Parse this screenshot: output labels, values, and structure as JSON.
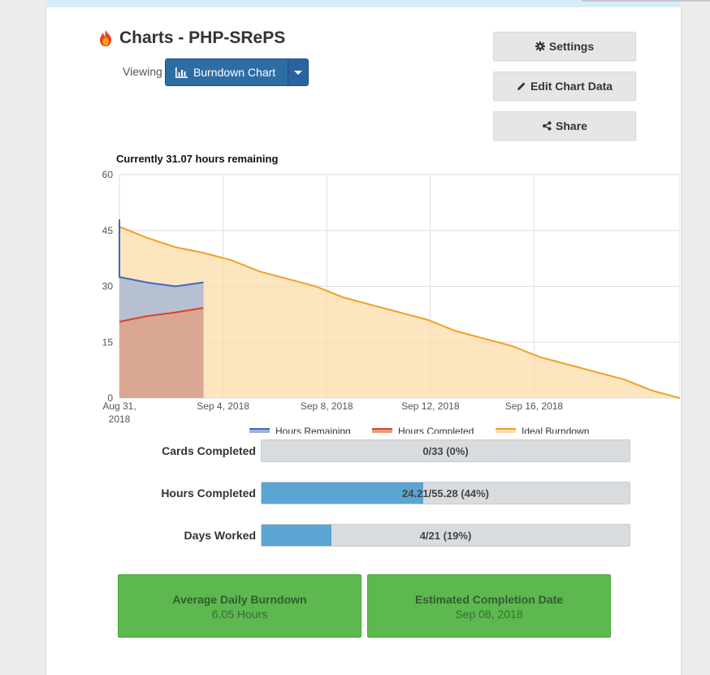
{
  "header": {
    "title": "Charts - PHP-SRePS",
    "viewing_label": "Viewing",
    "chart_selector": "Burndown Chart"
  },
  "actions": {
    "settings": "Settings",
    "edit_chart_data": "Edit Chart Data",
    "share": "Share"
  },
  "chart_data": {
    "type": "area",
    "title": "Currently 31.07 hours remaining",
    "xlabel": "",
    "ylabel": "",
    "ylim": [
      0,
      60
    ],
    "yticks": [
      0,
      15,
      30,
      45,
      60
    ],
    "x_tick_labels": [
      {
        "lines": [
          "Aug 31,",
          "2018"
        ],
        "day": 0
      },
      {
        "lines": [
          "Sep 4, 2018"
        ],
        "day": 4
      },
      {
        "lines": [
          "Sep 8, 2018"
        ],
        "day": 8
      },
      {
        "lines": [
          "Sep 12, 2018"
        ],
        "day": 12
      },
      {
        "lines": [
          "Sep 16, 2018"
        ],
        "day": 16
      }
    ],
    "xlim_days": [
      0,
      20
    ],
    "grid": true,
    "legend_position": "bottom",
    "series": [
      {
        "name": "Hours Remaining",
        "color": "#3b6bc4",
        "fill": "#9fb3d6",
        "x": [
          0,
          0,
          1,
          2,
          3
        ],
        "y": [
          48,
          32.5,
          31,
          30,
          31.07
        ]
      },
      {
        "name": "Hours Completed",
        "color": "#d9452b",
        "fill": "#e59f7e",
        "x": [
          0,
          1,
          2,
          3
        ],
        "y": [
          20.5,
          22,
          23,
          24.21
        ]
      },
      {
        "name": "Ideal Burndown",
        "color": "#f0a024",
        "fill": "#fcdcaa",
        "x": [
          0,
          1,
          2,
          3,
          4,
          5,
          6,
          7,
          8,
          9,
          10,
          11,
          12,
          13,
          14,
          15,
          16,
          17,
          18,
          19,
          20
        ],
        "y": [
          46,
          43,
          40.5,
          39,
          37,
          34,
          32,
          30,
          27,
          25,
          23,
          21,
          18,
          16,
          14,
          11,
          9,
          7,
          5,
          2,
          0
        ]
      }
    ]
  },
  "stats": [
    {
      "label": "Cards Completed",
      "text": "0/33 (0%)",
      "fraction": 0.0
    },
    {
      "label": "Hours Completed",
      "text": "24.21/55.28 (44%)",
      "fraction": 0.44
    },
    {
      "label": "Days Worked",
      "text": "4/21 (19%)",
      "fraction": 0.19
    }
  ],
  "tiles": {
    "avg_title": "Average Daily Burndown",
    "avg_value": "6.05 Hours",
    "completion_title": "Estimated Completion Date",
    "completion_value": "Sep 08, 2018"
  },
  "icons": {
    "title": "flame-icon",
    "chart": "bar-chart-icon",
    "settings": "gear-icon",
    "edit": "pencil-icon",
    "share": "share-icon"
  },
  "colors": {
    "primary_button": "#2e6da4",
    "progress_fill": "#5aa5d3",
    "tile_green": "#5cb84f"
  }
}
